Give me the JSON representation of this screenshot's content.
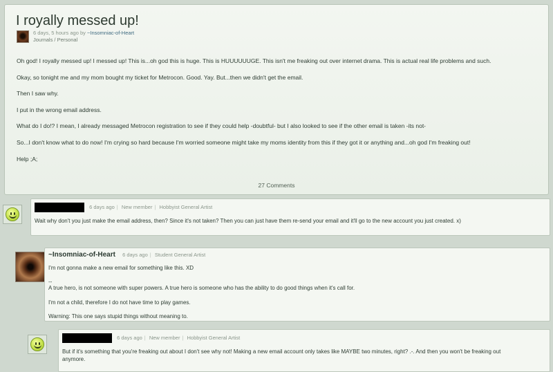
{
  "journal": {
    "title": "I royally messed up!",
    "meta_time": "6 days, 5 hours ago by",
    "meta_author": "~Insomniac-of-Heart",
    "categories": "Journals / Personal",
    "paragraphs": [
      "Oh god! I royally messed up! I messed up! This is...oh god this is huge. This is HUUUUUUGE. This isn't me freaking out over internet drama. This is actual real life problems and such.",
      "Okay, so tonight me and my mom bought my ticket for Metrocon. Good. Yay. But...then we didn't get the email.",
      "Then I saw why.",
      "I put in the wrong email address.",
      "What do I do!? I mean, I already messaged Metrocon registration to see if they could help -doubtful- but I also looked to see if the other email is taken -its not-",
      "So...I don't know what to do now! I'm crying so hard because I'm worried someone might take my moms identity from this if they got it or anything and...oh god I'm freaking out!",
      "Help ;A;"
    ],
    "comments_count": "27 Comments"
  },
  "comments": [
    {
      "author_hidden": true,
      "time": "6 days ago",
      "role1": "New member",
      "role2": "Hobbyist General Artist",
      "lines": [
        "Wait why don't you just make the email address, then? Since it's not taken? Then you can just have them re-send your email and it'll go to the new account you just created. x)"
      ]
    },
    {
      "author": "~Insomniac-of-Heart",
      "time": "6 days ago",
      "role1": "Student General Artist",
      "line1": "I'm not gonna make a new email for something like this. XD",
      "sig_dash": "--",
      "sig1": "A true hero, is not someone with super powers. A true hero is someone who has the ability to do good things when it's call for.",
      "sig2": "I'm not a child, therefore I do not have time to play games.",
      "sig3": "Warning: This one says stupid things without meaning to."
    },
    {
      "author_hidden": true,
      "time": "6 days ago",
      "role1": "New member",
      "role2": "Hobbyist General Artist",
      "line1": "But if it's something that you're freaking out about I don't see why not! Making a new email account only takes like MAYBE two minutes, right? .-. And then you won't be freaking out",
      "line2": "anymore."
    }
  ]
}
